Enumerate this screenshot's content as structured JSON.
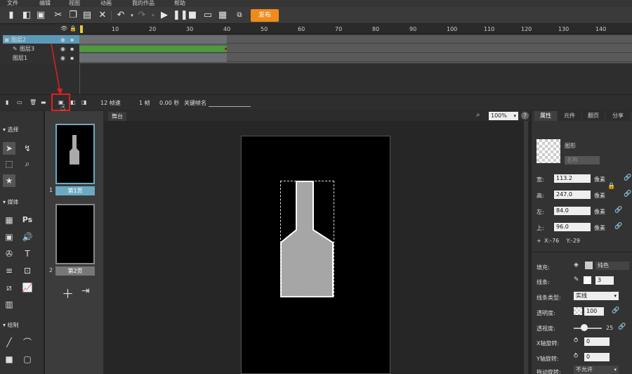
{
  "menu": {
    "items": [
      "文件",
      "编辑",
      "视图",
      "动画",
      "我的作品",
      "帮助"
    ]
  },
  "toolbar": {
    "publish_label": "发布"
  },
  "timeline": {
    "ticks": [
      "10",
      "20",
      "30",
      "40",
      "50",
      "60",
      "70",
      "80",
      "90",
      "100",
      "110",
      "120",
      "130",
      "140"
    ],
    "layers": [
      {
        "name": "图层2",
        "selected": true
      },
      {
        "name": "图层3",
        "selected": false
      },
      {
        "name": "图层1",
        "selected": false
      }
    ],
    "fps_label": "12 帧速",
    "frame_label": "1 帧",
    "time_label": "0.00 秒",
    "keyframe_name_label": "关键帧名"
  },
  "tools": {
    "select_section": "选择",
    "media_section": "媒体",
    "draw_section": "绘制",
    "ps_label": "Ps"
  },
  "pages": {
    "items": [
      {
        "number": "1",
        "label": "第1页",
        "selected": true
      },
      {
        "number": "2",
        "label": "第2页",
        "selected": false
      }
    ]
  },
  "stage": {
    "tab_label": "舞台",
    "zoom": "100%"
  },
  "props": {
    "tabs": [
      "属性",
      "元件",
      "翻页",
      "分享"
    ],
    "shape_type": "图形",
    "name_placeholder": "名称",
    "width_label": "宽:",
    "width_value": "113.2",
    "height_label": "高:",
    "height_value": "247.0",
    "left_label": "左:",
    "left_value": "84.0",
    "top_label": "上:",
    "top_value": "96.0",
    "unit": "像素",
    "coords": "X:-76    Y:-29",
    "fill_label": "填充:",
    "fill_value": "纯色",
    "stroke_label": "线条:",
    "stroke_value": "3",
    "stroke_type_label": "线条类型:",
    "stroke_type_value": "实线",
    "opacity_label": "透明度:",
    "opacity_value": "100",
    "blur_label": "透视度:",
    "blur_value": "25",
    "xrot_label": "X轴旋转:",
    "xrot_value": "0",
    "yrot_label": "Y轴旋转:",
    "yrot_value": "0",
    "drag_label": "拖动旋转:",
    "drag_value": "不允许"
  },
  "colors": {
    "accent": "#f08a1c",
    "layer_selected": "#5a9ab8",
    "tween": "#4f9a3f",
    "page_selected": "#6aaac4",
    "red_box": "#e02020"
  }
}
